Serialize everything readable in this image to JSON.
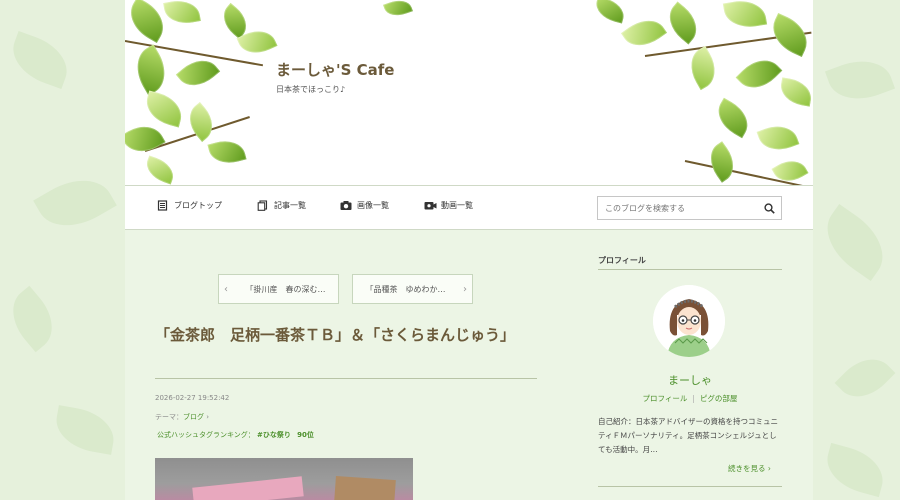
{
  "site": {
    "title": "まーしゃ'S Cafe",
    "subtitle": "日本茶でほっこり♪"
  },
  "nav": {
    "items": [
      {
        "label": "ブログトップ",
        "icon": "book-icon"
      },
      {
        "label": "記事一覧",
        "icon": "pages-icon"
      },
      {
        "label": "画像一覧",
        "icon": "camera-icon"
      },
      {
        "label": "動画一覧",
        "icon": "video-icon"
      }
    ],
    "search_placeholder": "このブログを検索する"
  },
  "pager": {
    "prev": "「掛川産　春の深む…",
    "next": "「品種茶　ゆめわか…"
  },
  "article": {
    "title": "「金茶郎　足柄一番茶ＴＢ」＆「さくらまんじゅう」",
    "date": "2026-02-27 19:52:42",
    "theme_label": "テーマ：",
    "theme_value": "ブログ",
    "hashtag_label": "公式ハッシュタグランキング：",
    "hashtag_tag": "#ひな祭り",
    "hashtag_rank": "90位"
  },
  "sidebar": {
    "heading": "プロフィール",
    "name": "まーしゃ",
    "link_profile": "プロフィール",
    "link_room": "ピグの部屋",
    "bio": "自己紹介：日本茶アドバイザーの資格を持つコミュニティＦＭパーソナリティ。足柄茶コンシェルジュとしても活動中。月…",
    "more": "続きを見る"
  },
  "colors": {
    "accent_green": "#4b8f2a",
    "title_brown": "#6b5a3a",
    "page_bg": "#ecf5e5"
  }
}
